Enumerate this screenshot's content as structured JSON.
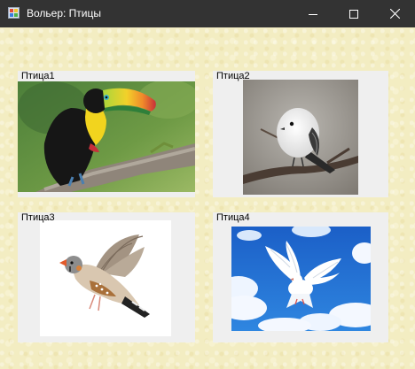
{
  "window": {
    "title": "Вольер: Птицы"
  },
  "titlebar_buttons": {
    "minimize_icon": "minimize-icon",
    "maximize_icon": "maximize-icon",
    "close_icon": "close-icon"
  },
  "birds": [
    {
      "label": "Птица1",
      "image": "toucan"
    },
    {
      "label": "Птица2",
      "image": "white-bird"
    },
    {
      "label": "Птица3",
      "image": "finch"
    },
    {
      "label": "Птица4",
      "image": "dove"
    }
  ],
  "colors": {
    "titlebar": "#333333",
    "background": "#f3edc2",
    "panel": "#efefef"
  }
}
